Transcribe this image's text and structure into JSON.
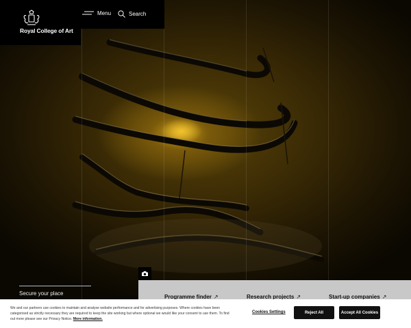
{
  "brand": {
    "name": "Royal College of Art",
    "logo_icon": "crest-icon"
  },
  "nav": {
    "menu_label": "Menu",
    "search_label": "Search"
  },
  "hero": {
    "caption_icon": "camera-icon"
  },
  "secure": {
    "label": "Secure your place"
  },
  "quick_links": [
    {
      "label": "Programme finder",
      "arrow": "↗"
    },
    {
      "label": "Research projects",
      "arrow": "↗"
    },
    {
      "label": "Start-up companies",
      "arrow": "↗"
    }
  ],
  "cookie": {
    "text": "We and our partners use cookies to maintain and analyse website performance and for advertising purposes. Where cookies have been categorised as strictly necessary they are required to keep the site working but where optional we would like your consent to use them. To find out more please see our Privacy Notice.",
    "more_link": "More information.",
    "settings_label": "Cookies Settings",
    "reject_label": "Reject All",
    "accept_label": "Accept All Cookies"
  },
  "colors": {
    "topbar": "#000000",
    "quicklinks_bg": "#c8c8c8",
    "cookie_bg": "#ffffff",
    "button_dark": "#111111"
  }
}
